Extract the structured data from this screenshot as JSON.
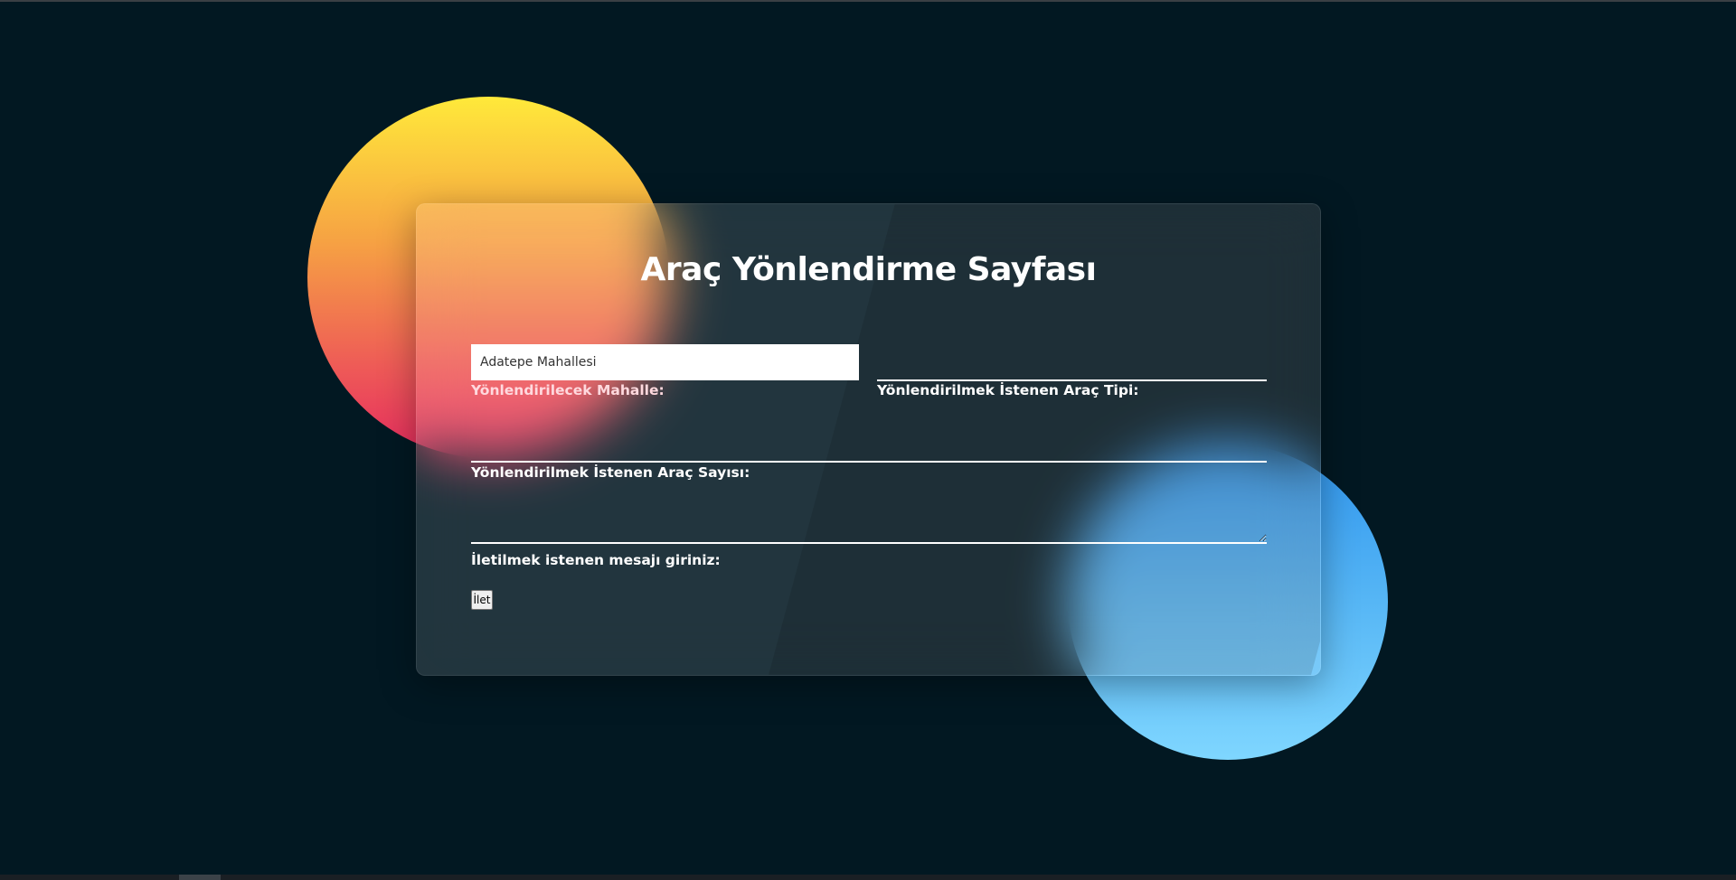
{
  "page": {
    "title": "Araç Yönlendirme Sayfası"
  },
  "form": {
    "mahalle": {
      "value": "Adatepe Mahallesi",
      "label": "Yönlendirilecek Mahalle:"
    },
    "arac_tipi": {
      "value": "",
      "label": "Yönlendirilmek İstenen Araç Tipi:"
    },
    "arac_sayisi": {
      "value": "",
      "label": "Yönlendirilmek İstenen Araç Sayısı:"
    },
    "mesaj": {
      "value": "",
      "label": "İletilmek istenen mesajı giriniz:"
    },
    "submit_label": "İlet"
  },
  "colors": {
    "background": "#021822",
    "warm_circle_top": "#ffe93a",
    "warm_circle_bottom": "#e62b5f",
    "cool_circle_top": "#2f95ee",
    "cool_circle_bottom": "#7fd6ff",
    "accent_label": "#ffd9de"
  }
}
